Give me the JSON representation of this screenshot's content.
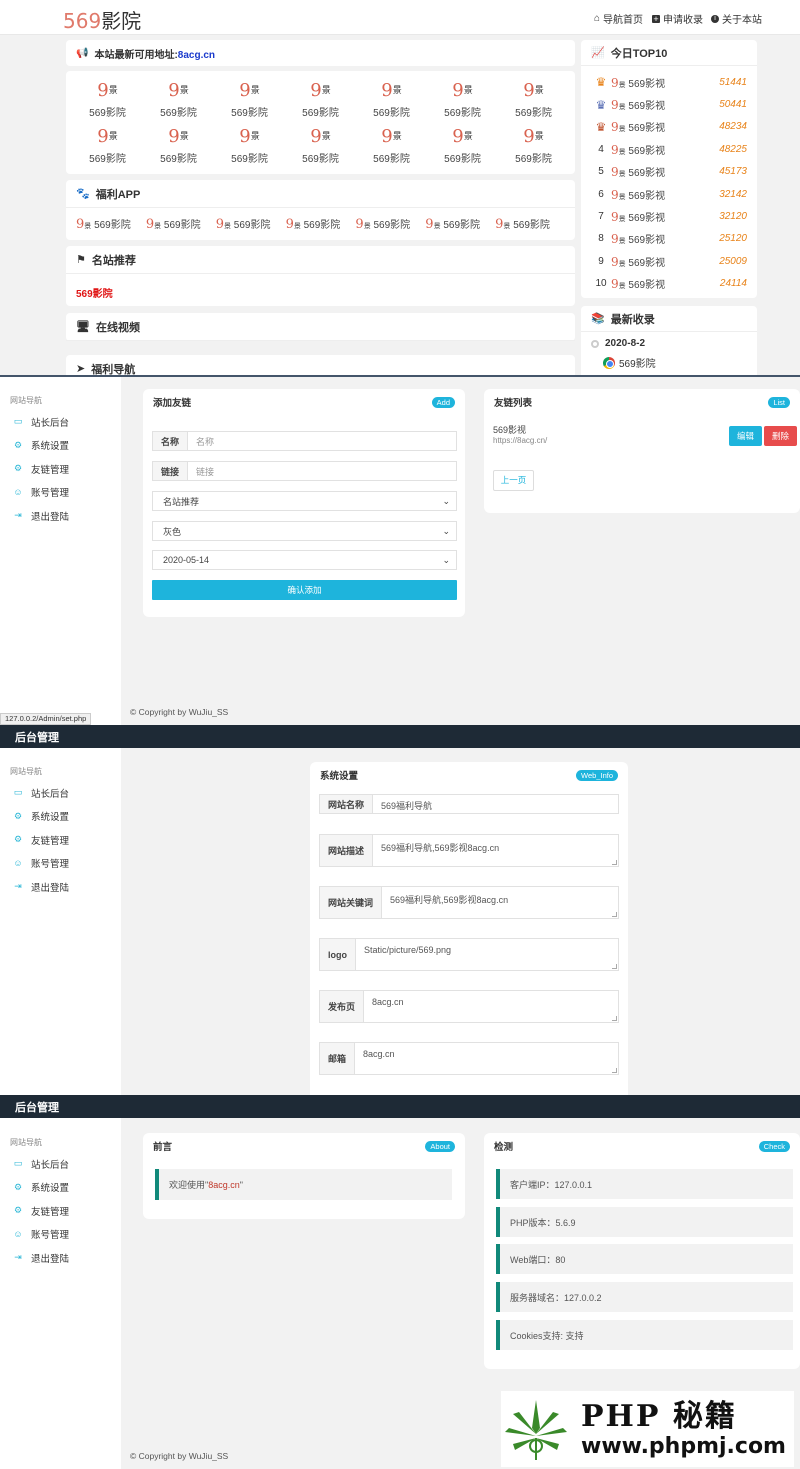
{
  "site": {
    "logo_num": "569",
    "logo_text": "影院",
    "nav": [
      "导航首页",
      "申请收录",
      "关于本站"
    ],
    "notice_prefix": "本站最新可用地址:",
    "notice_domain": "8acg.cn",
    "grid_label": "569影院",
    "welfare_app_title": "福利APP",
    "app_label": "569影院",
    "famous_title": "名站推荐",
    "famous_item": "569影院",
    "video_title": "在线视频",
    "welfare_nav_title": "福利导航",
    "top10_title": "今日TOP10",
    "top10": [
      {
        "rank": "1",
        "name": "569影视",
        "value": "51441"
      },
      {
        "rank": "2",
        "name": "569影视",
        "value": "50441"
      },
      {
        "rank": "3",
        "name": "569影视",
        "value": "48234"
      },
      {
        "rank": "4",
        "name": "569影视",
        "value": "48225"
      },
      {
        "rank": "5",
        "name": "569影视",
        "value": "45173"
      },
      {
        "rank": "6",
        "name": "569影视",
        "value": "32142"
      },
      {
        "rank": "7",
        "name": "569影视",
        "value": "32120"
      },
      {
        "rank": "8",
        "name": "569影视",
        "value": "25120"
      },
      {
        "rank": "9",
        "name": "569影视",
        "value": "25009"
      },
      {
        "rank": "10",
        "name": "569影视",
        "value": "24114"
      }
    ],
    "latest_title": "最新收录",
    "latest_date": "2020-8-2",
    "latest_item": "569影院"
  },
  "admin": {
    "header_title": "后台管理",
    "sidebar_title": "网站导航",
    "sidebar": [
      "站长后台",
      "系统设置",
      "友链管理",
      "账号管理",
      "退出登陆"
    ],
    "copyright": "© Copyright by WuJiu_SS",
    "status_url": "127.0.0.2/Admin/set.php"
  },
  "addlink": {
    "title": "添加友链",
    "tag": "Add",
    "name_label": "名称",
    "name_placeholder": "名称",
    "link_label": "链接",
    "link_placeholder": "链接",
    "category": "名站推荐",
    "color": "灰色",
    "date": "2020-05-14",
    "submit": "确认添加"
  },
  "linklist": {
    "title": "友链列表",
    "tag": "List",
    "item_name": "569影视",
    "item_url": "https://8acg.cn/",
    "edit": "编辑",
    "delete": "删除",
    "prev": "上一页"
  },
  "settings": {
    "title": "系统设置",
    "tag": "Web_Info",
    "fields": [
      {
        "label": "网站名称",
        "value": "569福利导航"
      },
      {
        "label": "网站描述",
        "value": "569福利导航,569影视8acg.cn"
      },
      {
        "label": "网站关键词",
        "value": "569福利导航,569影视8acg.cn"
      },
      {
        "label": "logo",
        "value": "Static/picture/569.png"
      },
      {
        "label": "发布页",
        "value": "8acg.cn"
      },
      {
        "label": "邮箱",
        "value": "8acg.cn"
      }
    ]
  },
  "about": {
    "title": "前言",
    "tag": "About",
    "welcome_prefix": "欢迎使用\"",
    "welcome_name": "8acg.cn",
    "welcome_suffix": "\""
  },
  "check": {
    "title": "检测",
    "tag": "Check",
    "items": [
      "客户端IP：127.0.0.1",
      "PHP版本：5.6.9",
      "Web端口：80",
      "服务器域名：127.0.0.2",
      "Cookies支持: 支持"
    ]
  },
  "watermark": {
    "brand": "PHP 秘籍",
    "url": "www.phpmj.com"
  },
  "colors": {
    "accent": "#1eb4dc",
    "admin_header": "#1e2a36",
    "danger": "#e74c4c",
    "quote_border": "#11897a",
    "rank_value": "#e8831a"
  }
}
